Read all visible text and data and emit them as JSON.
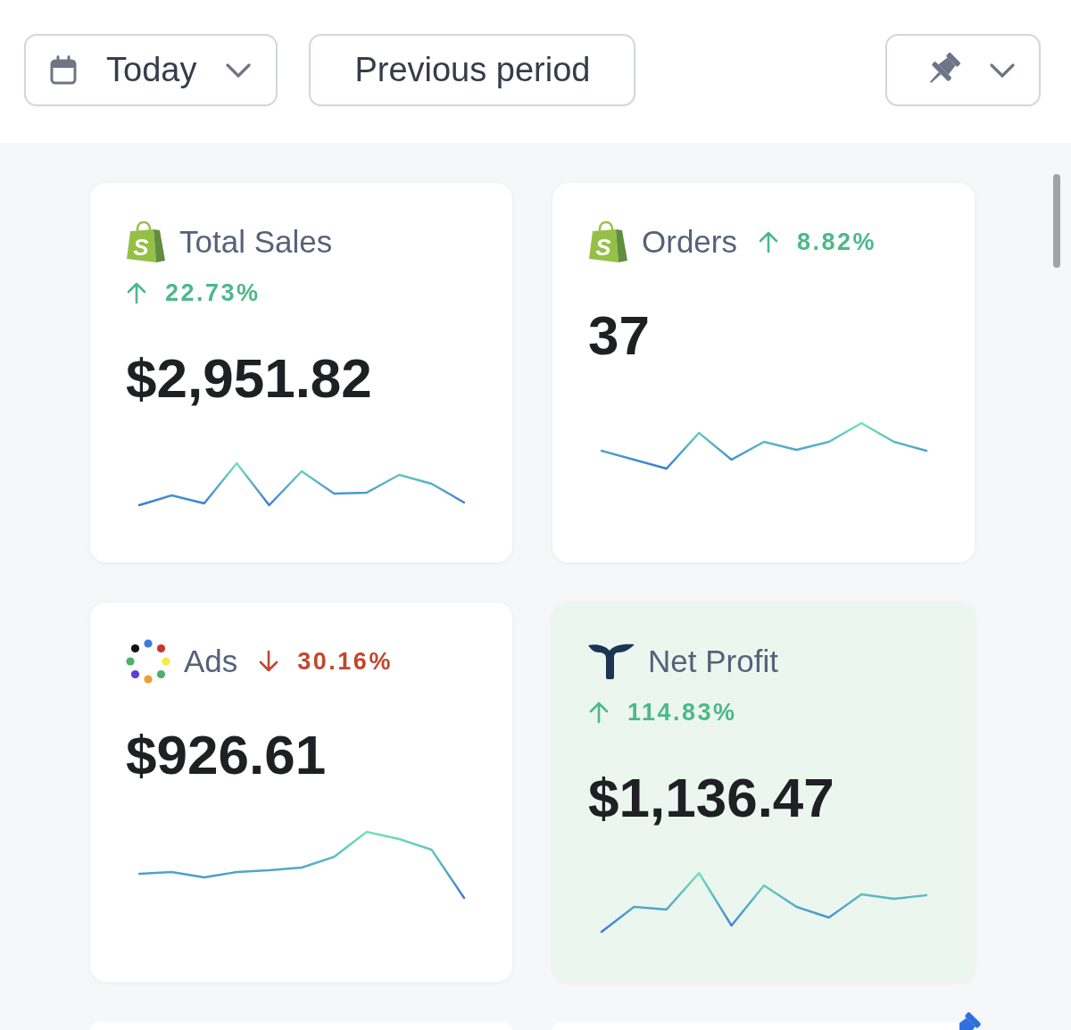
{
  "toolbar": {
    "date_range_button": {
      "label": "Today"
    },
    "compare_button": {
      "label": "Previous period"
    }
  },
  "cards": [
    {
      "kind": "store",
      "logo_letter": "S",
      "title": "Total Sales",
      "change": {
        "increase": true,
        "text": "22.73%"
      },
      "change_inline": false,
      "value": "$2,951.82",
      "highlighted": false
    },
    {
      "kind": "store",
      "logo_letter": "S",
      "title": "Orders",
      "change": {
        "increase": true,
        "text": "8.82%"
      },
      "change_inline": true,
      "value": "37",
      "highlighted": false
    },
    {
      "kind": "ads",
      "title": "Ads",
      "change": {
        "increase": false,
        "text": "30.16%"
      },
      "change_inline": true,
      "value": "$926.61",
      "highlighted": false
    },
    {
      "kind": "profit",
      "title": "Net Profit",
      "change": {
        "increase": true,
        "text": "114.83%"
      },
      "change_inline": false,
      "value": "$1,136.47",
      "highlighted": true
    }
  ],
  "partial_cards": [
    {
      "pinned": false
    },
    {
      "pinned": true
    }
  ]
}
